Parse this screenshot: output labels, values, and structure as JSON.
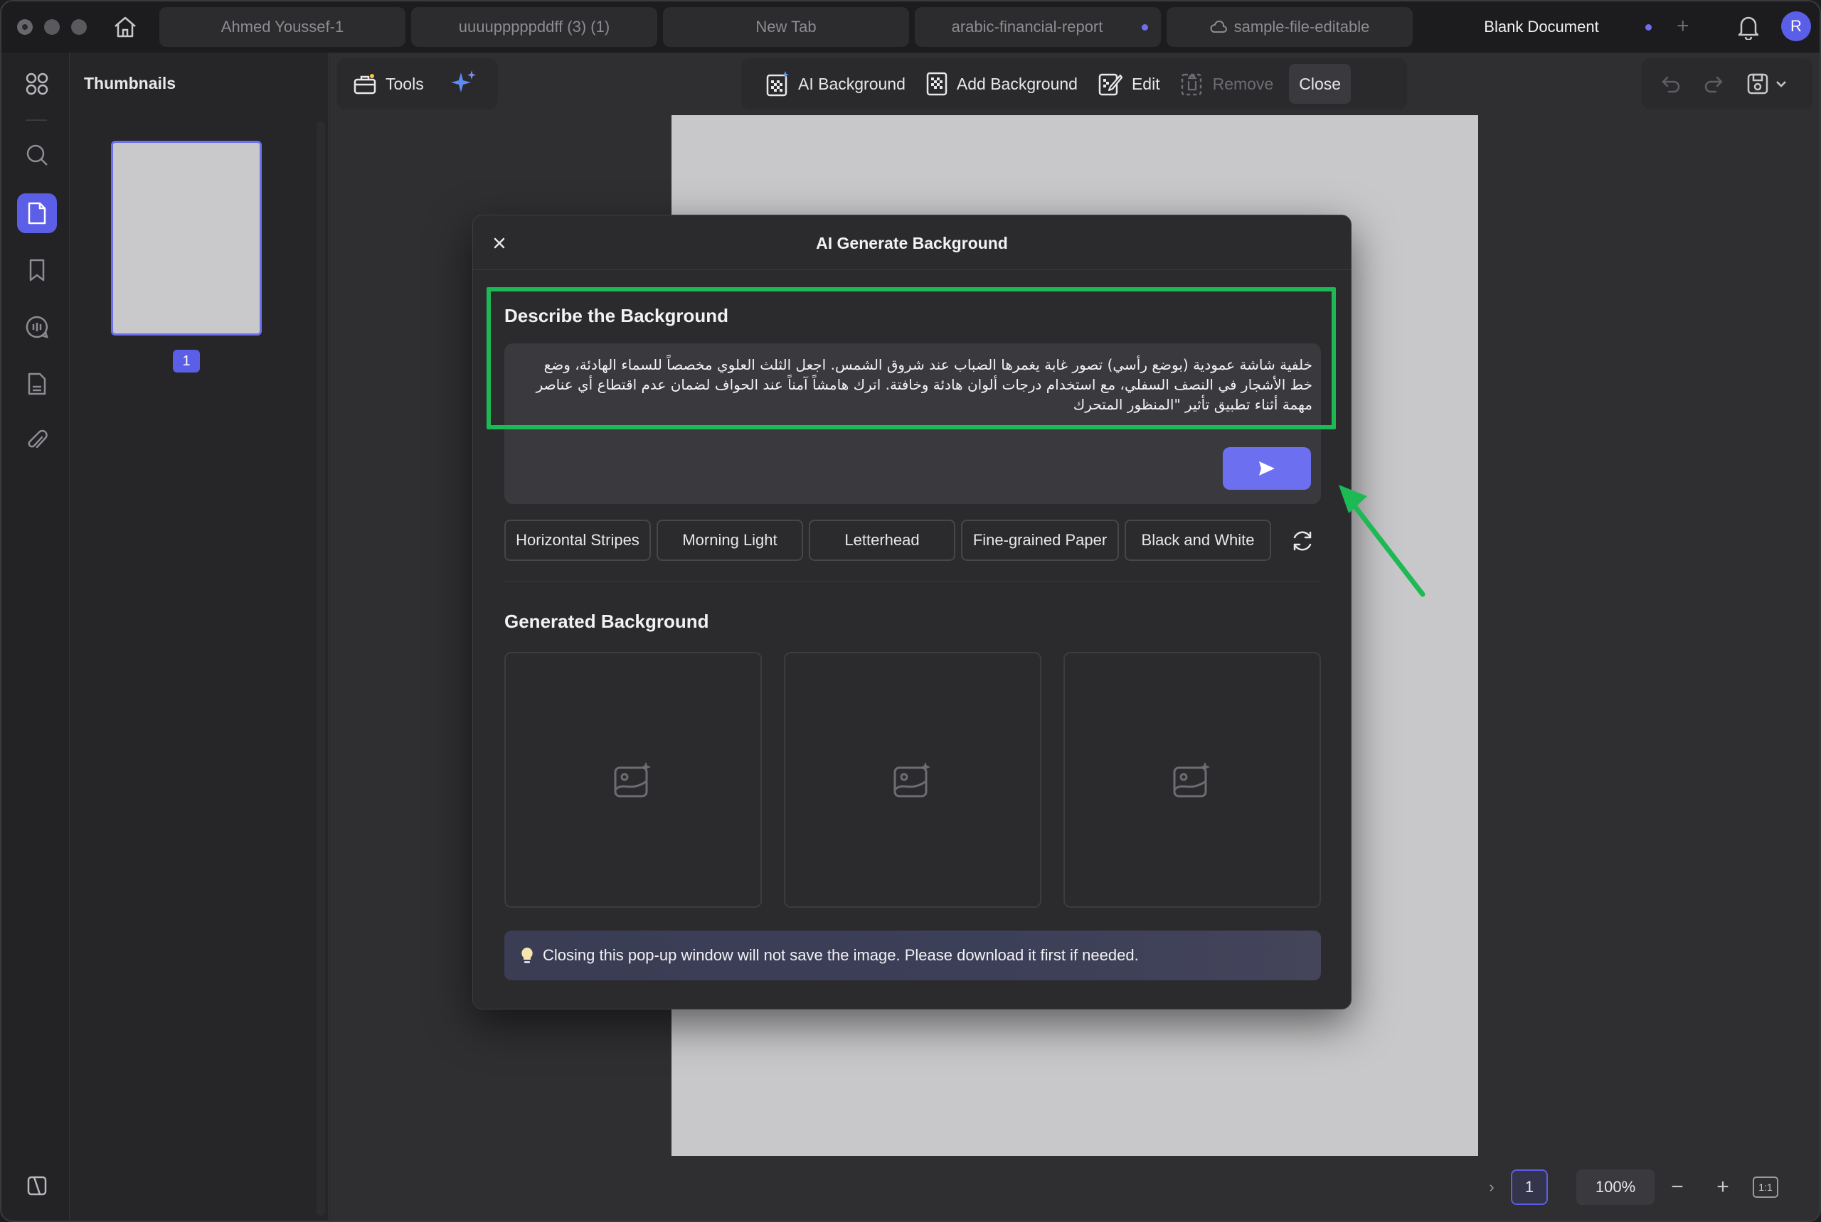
{
  "tabs": [
    {
      "label": "Ahmed Youssef-1",
      "active": false,
      "modified": false
    },
    {
      "label": "uuuupppppddff (3) (1)",
      "active": false,
      "modified": false
    },
    {
      "label": "New Tab",
      "active": false,
      "modified": false
    },
    {
      "label": "arabic-financial-report",
      "active": false,
      "modified": true
    },
    {
      "label": "sample-file-editable",
      "active": false,
      "modified": false
    },
    {
      "label": "Blank Document",
      "active": true,
      "modified": true
    }
  ],
  "user": {
    "initial": "R"
  },
  "thumbnails": {
    "title": "Thumbnails",
    "page_number": "1"
  },
  "toolbar": {
    "tools_label": "Tools",
    "ai_background": "AI Background",
    "add_background": "Add Background",
    "edit": "Edit",
    "remove": "Remove",
    "close": "Close"
  },
  "bottom": {
    "page": "1",
    "zoom": "100%",
    "fit": "1:1"
  },
  "modal": {
    "title": "AI Generate Background",
    "describe_title": "Describe the Background",
    "prompt_text": "خلفية شاشة عمودية (بوضع رأسي) تصور غابة يغمرها الضباب عند شروق الشمس. اجعل الثلث العلوي مخصصاً للسماء الهادئة، وضع خط الأشجار في النصف السفلي، مع استخدام درجات ألوان هادئة وخافتة. اترك هامشاً آمناً عند الحواف لضمان عدم اقتطاع أي عناصر مهمة أثناء تطبيق تأثير \"المنظور المتحرك",
    "chips": [
      "Horizontal Stripes",
      "Morning Light",
      "Letterhead",
      "Fine-grained Paper",
      "Black and White"
    ],
    "generated_title": "Generated Background",
    "notice": "Closing this pop-up window will not save the image. Please download it first if needed."
  },
  "colors": {
    "accent": "#6b6ff0",
    "highlight": "#1db954"
  }
}
